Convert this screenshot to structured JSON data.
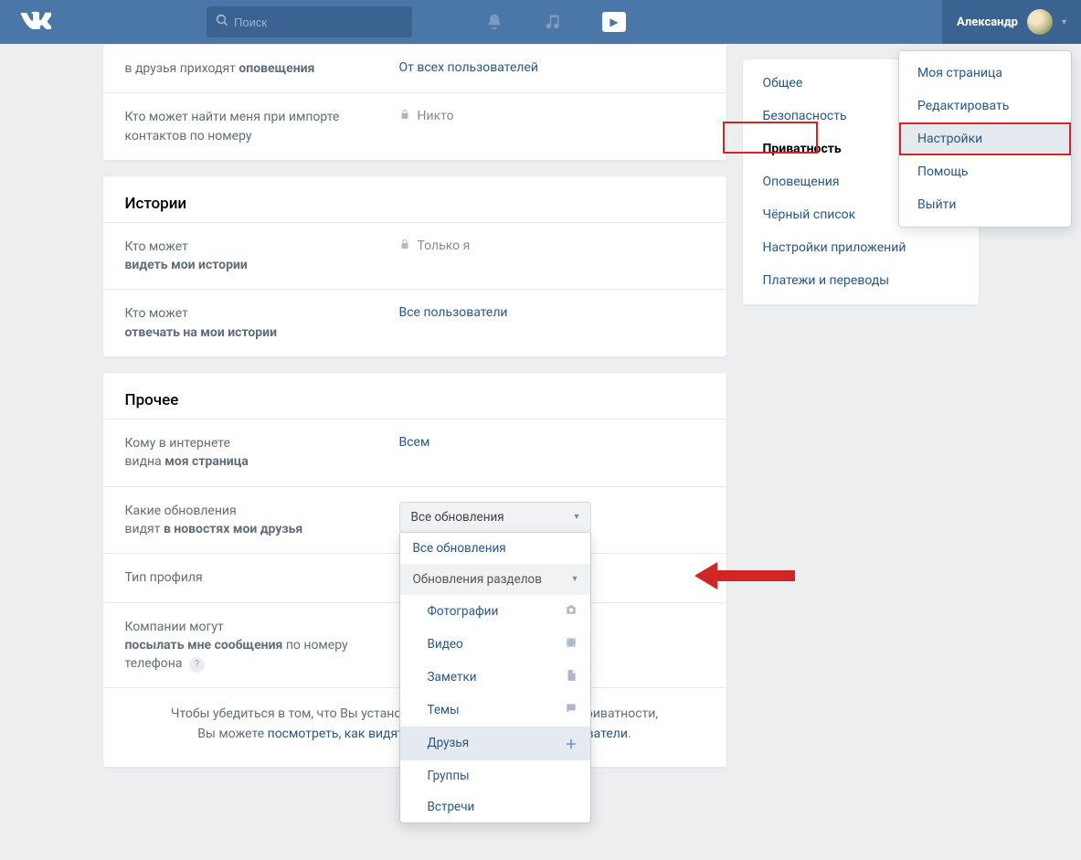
{
  "header": {
    "search_placeholder": "Поиск",
    "user_name": "Александр"
  },
  "user_menu": {
    "items": [
      "Моя страница",
      "Редактировать",
      "Настройки",
      "Помощь",
      "Выйти"
    ]
  },
  "sidebar": {
    "items": [
      "Общее",
      "Безопасность",
      "Приватность",
      "Оповещения",
      "Чёрный список",
      "Настройки приложений",
      "Платежи и переводы"
    ],
    "active_index": 2
  },
  "panel_top": {
    "rows": [
      {
        "label_pre": "в друзья приходят ",
        "label_bold": "оповещения",
        "value": "От всех пользователей"
      },
      {
        "label": "Кто может найти меня при импорте контактов по номеру",
        "value": "Никто",
        "locked": true
      }
    ]
  },
  "panel_stories": {
    "title": "Истории",
    "rows": [
      {
        "label_pre": "Кто может",
        "label_bold": "видеть мои истории",
        "value": "Только я",
        "locked": true
      },
      {
        "label_pre": "Кто может",
        "label_bold": "отвечать на мои истории",
        "value": "Все пользователи"
      }
    ]
  },
  "panel_other": {
    "title": "Прочее",
    "rows": [
      {
        "label_pre": "Кому в интернете",
        "label_br": true,
        "label_mid": "видна ",
        "label_bold": "моя страница",
        "value": "Всем"
      },
      {
        "label_pre": "Какие обновления",
        "label_br": true,
        "label_mid": "видят ",
        "label_bold": "в новостях мои друзья",
        "dropdown": true
      },
      {
        "label": "Тип профиля",
        "value": ""
      },
      {
        "label_pre": "Компании могут",
        "label_br": true,
        "label_mid": "",
        "label_bold": "посылать мне сообщения",
        "label_post": " по номеру телефона",
        "help": true,
        "value": ""
      }
    ],
    "dropdown": {
      "selected": "Все обновления",
      "option_all": "Все обновления",
      "sections_header": "Обновления разделов",
      "sections": [
        {
          "label": "Фотографии",
          "icon": "camera"
        },
        {
          "label": "Видео",
          "icon": "video"
        },
        {
          "label": "Заметки",
          "icon": "note"
        },
        {
          "label": "Темы",
          "icon": "chat"
        },
        {
          "label": "Друзья",
          "icon": "plus",
          "selected": true
        },
        {
          "label": "Группы",
          "icon": ""
        },
        {
          "label": "Встречи",
          "icon": ""
        }
      ]
    },
    "footer_pre": "Чтобы убедиться в том, что Вы установили подходящие настройки приватности,",
    "footer_mid": "Вы можете ",
    "footer_link": "посмотреть, как видят Вашу страницу другие пользователи",
    "footer_post": "."
  }
}
